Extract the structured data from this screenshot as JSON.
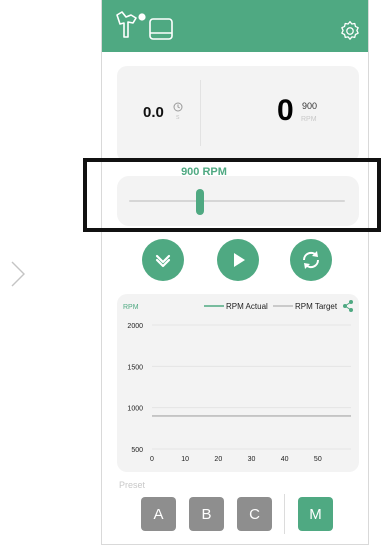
{
  "colors": {
    "accent": "#4fa982",
    "card": "#f3f3f3",
    "preset_inactive": "#8e8e8e",
    "preset_active": "#4fa982"
  },
  "header": {
    "icons": [
      "centrifuge-logo-icon",
      "panel-icon",
      "gear-icon"
    ]
  },
  "stats": {
    "time_value": "0.0",
    "time_unit": "s",
    "rpm_value": "0",
    "rpm_target": "900",
    "rpm_unit": "RPM"
  },
  "speed_slider": {
    "label": "900 RPM",
    "value_rpm": 900,
    "position": 0.33
  },
  "controls": [
    {
      "name": "ramp-down-button",
      "icon": "chevron-down-icon"
    },
    {
      "name": "start-button",
      "icon": "play-icon"
    },
    {
      "name": "cycle-button",
      "icon": "sync-icon"
    }
  ],
  "chart_data": {
    "type": "line",
    "ylabel": "RPM",
    "legend": [
      "RPM Actual",
      "RPM Target"
    ],
    "legend_placement": "top-right",
    "x_ticks": [
      "0",
      "10",
      "20",
      "30",
      "40",
      "50"
    ],
    "y_ticks": [
      "500",
      "1000",
      "1500",
      "2000"
    ],
    "xlim": [
      0,
      60
    ],
    "ylim": [
      500,
      2000
    ],
    "series": [
      {
        "name": "RPM Actual",
        "x": [],
        "y": [],
        "color": "#4fa982"
      },
      {
        "name": "RPM Target",
        "x": [
          0,
          60
        ],
        "y": [
          900,
          900
        ],
        "color": "#bdbdbd"
      }
    ],
    "grid": true
  },
  "presets": {
    "label": "Preset",
    "buttons": [
      {
        "label": "A",
        "active": false
      },
      {
        "label": "B",
        "active": false
      },
      {
        "label": "C",
        "active": false
      },
      {
        "label": "M",
        "active": true
      }
    ]
  }
}
